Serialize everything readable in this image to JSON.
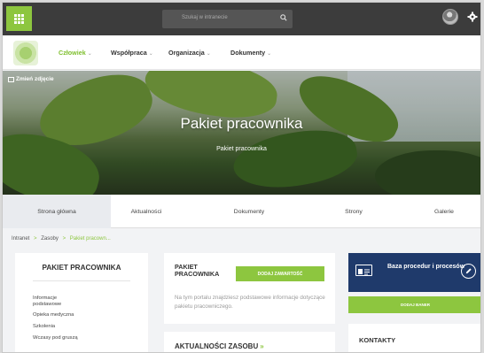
{
  "topbar": {
    "search_placeholder": "Szukaj w intranecie",
    "apps_icon": "grid-icon",
    "search_icon": "search-icon",
    "settings_icon": "gear-icon"
  },
  "nav": {
    "items": [
      {
        "label": "Człowiek",
        "active": true
      },
      {
        "label": "Współpraca"
      },
      {
        "label": "Organizacja"
      },
      {
        "label": "Dokumenty"
      }
    ],
    "caret": "⌄"
  },
  "hero": {
    "change_photo": "Zmień zdjęcie",
    "title": "Pakiet pracownika",
    "subtitle": "Pakiet pracownika"
  },
  "tabs": [
    {
      "label": "Strona główna",
      "active": true
    },
    {
      "label": "Aktualności"
    },
    {
      "label": "Dokumenty"
    },
    {
      "label": "Strony"
    },
    {
      "label": "Galerie"
    }
  ],
  "breadcrumb": {
    "items": [
      "Intranet",
      "Zasoby",
      "Pakiet pracown..."
    ],
    "separator": ">"
  },
  "left_panel": {
    "title": "PAKIET PRACOWNIKA",
    "items": [
      "Informacje podstawowe",
      "Opieka medyczna",
      "Szkolenia",
      "Wczasy pod gruszą"
    ]
  },
  "center_panel": {
    "title": "PAKIET PRACOWNIKA",
    "add_button": "DODAJ ZAWARTOŚĆ",
    "description": "Na tym portalu znajdziesz podstawowe informacje dotyczące pakietu pracowniczego."
  },
  "news": {
    "title": "AKTUALNOŚCI ZASOBU",
    "arrow": "»"
  },
  "right_col": {
    "proc_title": "Baza procedur i procesów",
    "banner_button": "DODAJ BANER",
    "contacts_title": "KONTAKTY"
  },
  "colors": {
    "accent": "#8dc63f",
    "topbar": "#3c3c3c",
    "navy": "#1f3a6b"
  }
}
